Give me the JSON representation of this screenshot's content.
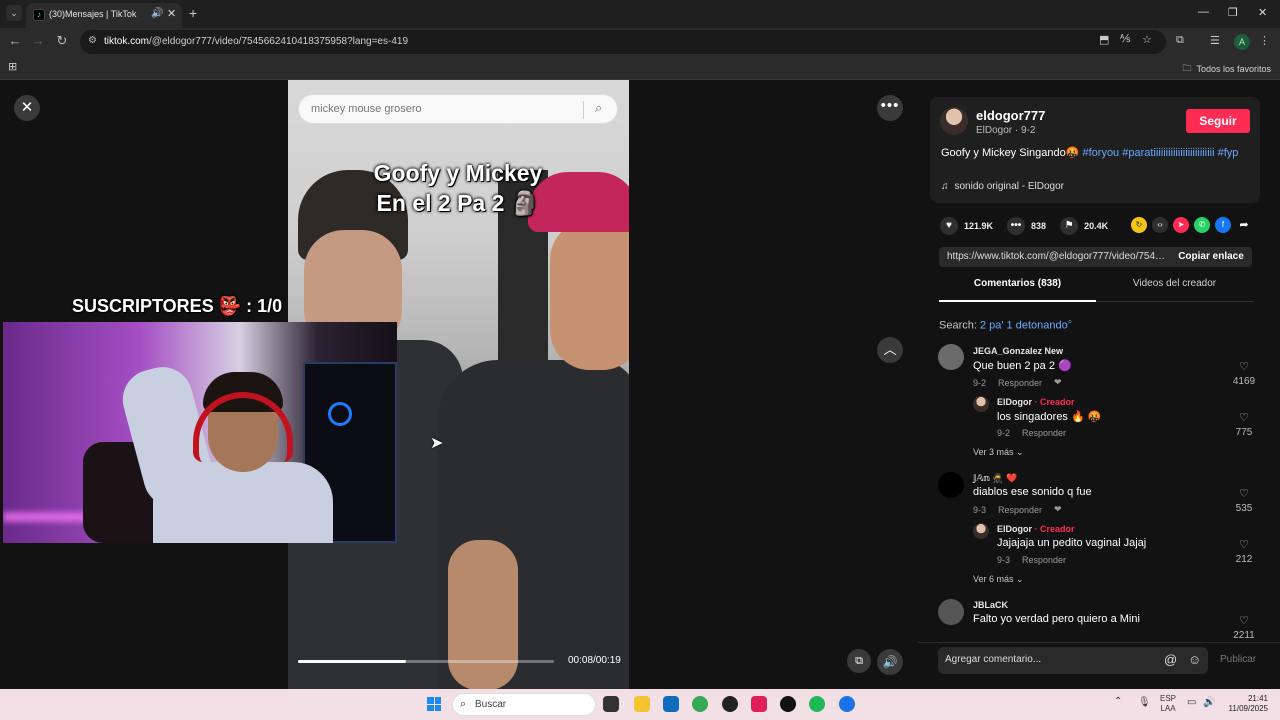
{
  "browser": {
    "tab_title": "(30)Mensajes | TikTok",
    "url_host": "tiktok.com",
    "url_path": "/@eldogor777/video/7545662410418375958?lang=es-419",
    "bookmarks_label": "Todos los favoritos",
    "profile_initial": "A"
  },
  "video": {
    "search_query": "mickey mouse grosero",
    "overlay_line1": "Goofy y Mickey",
    "overlay_line2": "En el 2 Pa 2 🗿",
    "subs_label": "SUSCRIPTORES 👺 : 1/0",
    "time": "00:08/00:19",
    "progress": 0.42
  },
  "creator": {
    "username": "eldogor777",
    "display": "ElDogor · 9-2",
    "follow_label": "Seguir",
    "caption_text": "Goofy y Mickey Singando🤬 ",
    "tags": [
      "#foryou",
      "#paratiiiiiiiiiiiiiiiiiiiiiiiii",
      "#fyp"
    ],
    "sound": "sonido original - ElDogor"
  },
  "stats": {
    "likes": "121.9K",
    "comments": "838",
    "saves": "20.4K"
  },
  "share": {
    "link": "https://www.tiktok.com/@eldogor777/video/7545...",
    "copy_label": "Copiar enlace"
  },
  "tabs": {
    "comments": "Comentarios (838)",
    "videos": "Videos del creador"
  },
  "search_suggest": {
    "prefix": "Search: ",
    "term": "2 pa' 1 detonando"
  },
  "comments": [
    {
      "name": "JEGA_Gonzalez New",
      "text": "Que buen 2 pa 2 🟣",
      "date": "9-2",
      "reply": "Responder",
      "likes": "4169"
    },
    {
      "name": "ElDogor",
      "creator": "· Creador",
      "text": "los singadores 🔥 🤬",
      "date": "9-2",
      "reply": "Responder",
      "likes": "775"
    },
    {
      "name": "𝕁𝔸𝕟 🥷 ❤️",
      "text": "diablos ese sonido q fue",
      "date": "9-3",
      "reply": "Responder",
      "likes": "535"
    },
    {
      "name": "ElDogor",
      "creator": "· Creador",
      "text": "Jajajaja un pedito vaginal Jajaj",
      "date": "9-3",
      "reply": "Responder",
      "likes": "212"
    },
    {
      "name": "JBLaCK",
      "text": "Falto yo verdad pero quiero a Mini",
      "likes": "2211"
    }
  ],
  "more_replies": [
    "Ver 3 más",
    "Ver 6 más"
  ],
  "comment_input": {
    "placeholder": "Agregar comentario...",
    "post_label": "Publicar"
  },
  "taskbar": {
    "search_placeholder": "Buscar",
    "lang_top": "ESP",
    "lang_bottom": "LAA",
    "time": "21:41",
    "date": "11/09/2025"
  }
}
